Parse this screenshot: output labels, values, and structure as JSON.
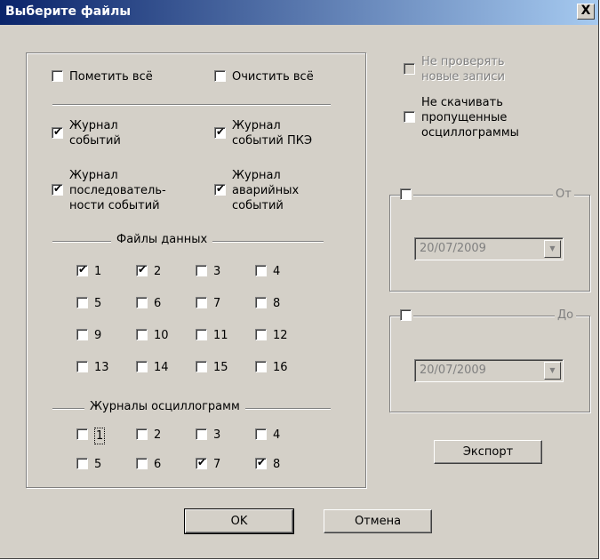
{
  "window": {
    "title": "Выберите файлы",
    "close_label": "X"
  },
  "top": {
    "mark_all": {
      "label": "Пометить всё",
      "checked": false
    },
    "clear_all": {
      "label": "Очистить всё",
      "checked": false
    }
  },
  "journals": {
    "events": {
      "label": "Журнал\nсобытий",
      "checked": true
    },
    "pke_events": {
      "label": "Журнал\nсобытий ПКЭ",
      "checked": true
    },
    "sequence_events": {
      "label": "Журнал\nпоследователь-\nности событий",
      "checked": true
    },
    "alarm_events": {
      "label": "Журнал\nаварийных\nсобытий",
      "checked": true
    }
  },
  "data_files": {
    "title": "Файлы данных",
    "items": [
      {
        "label": "1",
        "checked": true
      },
      {
        "label": "2",
        "checked": true
      },
      {
        "label": "3",
        "checked": false
      },
      {
        "label": "4",
        "checked": false
      },
      {
        "label": "5",
        "checked": false
      },
      {
        "label": "6",
        "checked": false
      },
      {
        "label": "7",
        "checked": false
      },
      {
        "label": "8",
        "checked": false
      },
      {
        "label": "9",
        "checked": false
      },
      {
        "label": "10",
        "checked": false
      },
      {
        "label": "11",
        "checked": false
      },
      {
        "label": "12",
        "checked": false
      },
      {
        "label": "13",
        "checked": false
      },
      {
        "label": "14",
        "checked": false
      },
      {
        "label": "15",
        "checked": false
      },
      {
        "label": "16",
        "checked": false
      }
    ]
  },
  "osc_journals": {
    "title": "Журналы осциллограмм",
    "items": [
      {
        "label": "1",
        "checked": false
      },
      {
        "label": "2",
        "checked": false
      },
      {
        "label": "3",
        "checked": false
      },
      {
        "label": "4",
        "checked": false
      },
      {
        "label": "5",
        "checked": false
      },
      {
        "label": "6",
        "checked": false
      },
      {
        "label": "7",
        "checked": true
      },
      {
        "label": "8",
        "checked": true
      }
    ]
  },
  "right": {
    "no_check_new": {
      "label": "Не проверять\nновые записи",
      "checked": false,
      "disabled": true
    },
    "no_download_missed": {
      "label": "Не скачивать\nпропущенные\nосциллограммы",
      "checked": false
    }
  },
  "from_group": {
    "label": "От",
    "checked": false,
    "date": "20/07/2009"
  },
  "to_group": {
    "label": "До",
    "checked": false,
    "date": "20/07/2009"
  },
  "buttons": {
    "export": "Экспорт",
    "ok": "OK",
    "cancel": "Отмена"
  },
  "check_mark": "✔",
  "combo_arrow": "▼"
}
